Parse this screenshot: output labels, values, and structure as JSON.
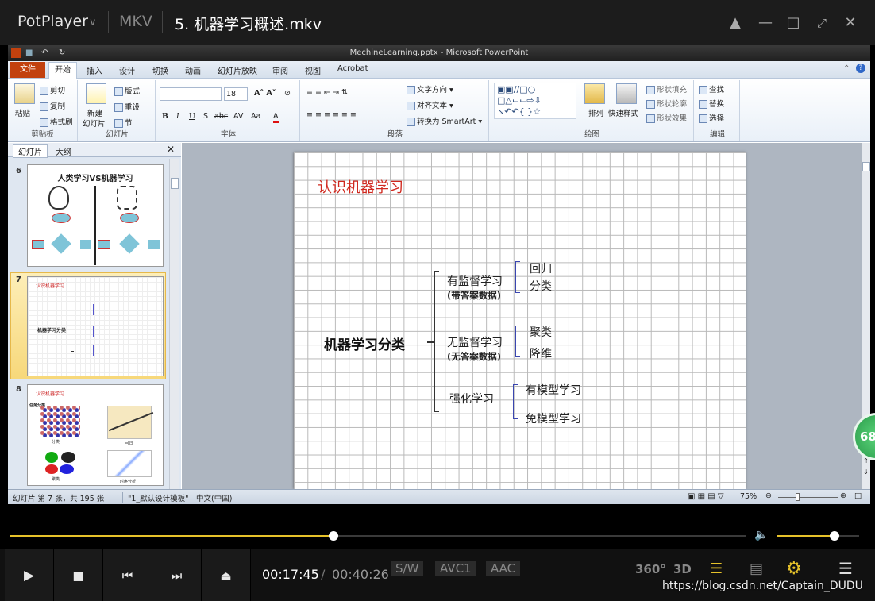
{
  "player": {
    "app_name": "PotPlayer",
    "format": "MKV",
    "file_name": "5. 机器学习概述.mkv",
    "time_current": "00:17:45",
    "time_separator": "/",
    "time_total": "00:40:26",
    "badges": [
      "S/W",
      "AVC1",
      "AAC"
    ],
    "icons_right": [
      "360°",
      "3D"
    ],
    "progress": 0.44,
    "volume": 0.7,
    "overlay_number": "68",
    "watermark": "https://blog.csdn.net/Captain_DUDU"
  },
  "ppt": {
    "window_title": "MechineLearning.pptx - Microsoft PowerPoint",
    "file_tab": "文件",
    "tabs": [
      "开始",
      "插入",
      "设计",
      "切换",
      "动画",
      "幻灯片放映",
      "审阅",
      "视图",
      "Acrobat"
    ],
    "ribbon": {
      "clipboard": {
        "paste": "粘贴",
        "cut": "剪切",
        "copy": "复制",
        "format_painter": "格式刷",
        "label": "剪贴板"
      },
      "slides": {
        "new_slide": "新建",
        "new_slide2": "幻灯片",
        "layout": "版式",
        "reset": "重设",
        "section": "节",
        "label": "幻灯片"
      },
      "font": {
        "size": "18",
        "label": "字体"
      },
      "paragraph": {
        "text_direction": "文字方向",
        "align_text": "对齐文本",
        "smartart": "转换为 SmartArt",
        "label": "段落"
      },
      "drawing": {
        "arrange": "排列",
        "quick_styles": "快速样式",
        "shape_fill": "形状填充",
        "shape_outline": "形状轮廓",
        "shape_effects": "形状效果",
        "label": "绘图"
      },
      "editing": {
        "find": "查找",
        "replace": "替换",
        "select": "选择",
        "label": "编辑"
      }
    },
    "left_tabs": [
      "幻灯片",
      "大纲"
    ],
    "thumbnails": [
      {
        "num": "6",
        "title": "人类学习VS机器学习"
      },
      {
        "num": "7",
        "title": "认识机器学习",
        "center": "机器学习分类"
      },
      {
        "num": "8",
        "title": "认识机器学习",
        "left_top": "任务分类",
        "labels": [
          "分类",
          "回归",
          "聚类",
          "时序分析"
        ]
      }
    ],
    "status": {
      "slide_info": "幻灯片 第 7 张，共 195 张",
      "theme": "\"1_默认设计模板\"",
      "language": "中文(中国)",
      "zoom": "75%"
    }
  },
  "slide": {
    "title": "认识机器学习",
    "root": "机器学习分类",
    "branches": [
      {
        "name": "有监督学习",
        "sub": "(带答案数据)",
        "leaves": [
          "回归",
          "分类"
        ]
      },
      {
        "name": "无监督学习",
        "sub": "(无答案数据)",
        "leaves": [
          "聚类",
          "降维"
        ]
      },
      {
        "name": "强化学习",
        "sub": "",
        "leaves": [
          "有模型学习",
          "免模型学习"
        ]
      }
    ]
  }
}
